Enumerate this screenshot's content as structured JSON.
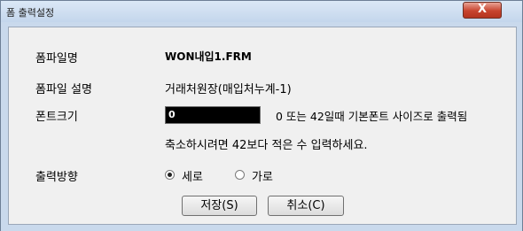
{
  "window": {
    "title": "폼 출력설정",
    "close_symbol": "X"
  },
  "form": {
    "form_name_label": "폼파일명",
    "form_name_value": "WON내입1.FRM",
    "form_desc_label": "폼파일 설명",
    "form_desc_value": "거래처원장(매입처누계-1)",
    "font_size_label": "폰트크기",
    "font_size_value": "0",
    "font_hint_line1": "0 또는 42일때 기본폰트 사이즈로 출력됨",
    "font_hint_line2": "축소하시려면 42보다 적은 수 입력하세요.",
    "direction_label": "출력방향",
    "direction_options": [
      "세로",
      "가로"
    ],
    "direction_selected": "세로"
  },
  "buttons": {
    "save": "저장(S)",
    "cancel": "취소(C)"
  }
}
